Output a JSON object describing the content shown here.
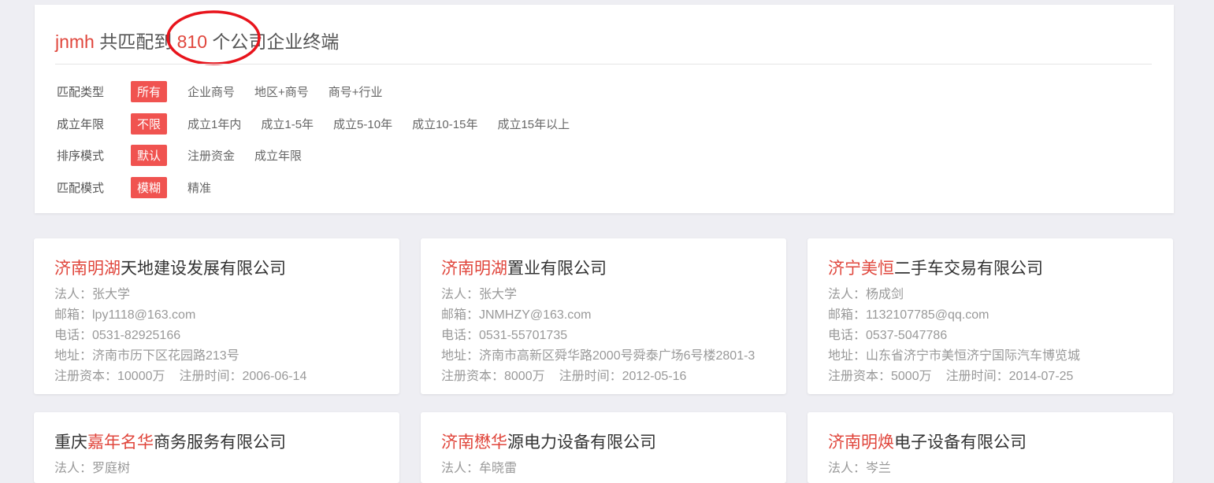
{
  "summary": {
    "keyword": "jnmh",
    "prefix": " 共匹配到 ",
    "count": "810",
    "suffix": " 个公司企业终端"
  },
  "filters": [
    {
      "label": "匹配类型",
      "options": [
        "所有",
        "企业商号",
        "地区+商号",
        "商号+行业"
      ],
      "active": 0
    },
    {
      "label": "成立年限",
      "options": [
        "不限",
        "成立1年内",
        "成立1-5年",
        "成立5-10年",
        "成立10-15年",
        "成立15年以上"
      ],
      "active": 0
    },
    {
      "label": "排序模式",
      "options": [
        "默认",
        "注册资金",
        "成立年限"
      ],
      "active": 0
    },
    {
      "label": "匹配模式",
      "options": [
        "模糊",
        "精准"
      ],
      "active": 0
    }
  ],
  "companies": [
    {
      "name_pre": "",
      "name_hl": "济南明湖",
      "name_post": "天地建设发展有限公司",
      "legal": "法人：张大学",
      "email": "邮箱：lpy1118@163.com",
      "phone": "电话：0531-82925166",
      "address": "地址：济南市历下区花园路213号",
      "capital": "注册资本：10000万",
      "reg_date": "注册时间：2006-06-14"
    },
    {
      "name_pre": "",
      "name_hl": "济南明湖",
      "name_post": "置业有限公司",
      "legal": "法人：张大学",
      "email": "邮箱：JNMHZY@163.com",
      "phone": "电话：0531-55701735",
      "address": "地址：济南市高新区舜华路2000号舜泰广场6号楼2801-3",
      "capital": "注册资本：8000万",
      "reg_date": "注册时间：2012-05-16"
    },
    {
      "name_pre": "",
      "name_hl": "济宁美恒",
      "name_post": "二手车交易有限公司",
      "legal": "法人：杨成剑",
      "email": "邮箱：1132107785@qq.com",
      "phone": "电话：0537-5047786",
      "address": "地址：山东省济宁市美恒济宁国际汽车博览城",
      "capital": "注册资本：5000万",
      "reg_date": "注册时间：2014-07-25"
    },
    {
      "name_pre": "重庆",
      "name_hl": "嘉年名华",
      "name_post": "商务服务有限公司",
      "legal": "法人：罗庭树"
    },
    {
      "name_pre": "",
      "name_hl": "济南懋华",
      "name_post": "源电力设备有限公司",
      "legal": "法人：牟晓雷"
    },
    {
      "name_pre": "",
      "name_hl": "济南明焕",
      "name_post": "电子设备有限公司",
      "legal": "法人：岑兰"
    }
  ],
  "colors": {
    "accent": "#e0463c",
    "active_tag": "#f05350",
    "annotation": "#e8141c"
  }
}
